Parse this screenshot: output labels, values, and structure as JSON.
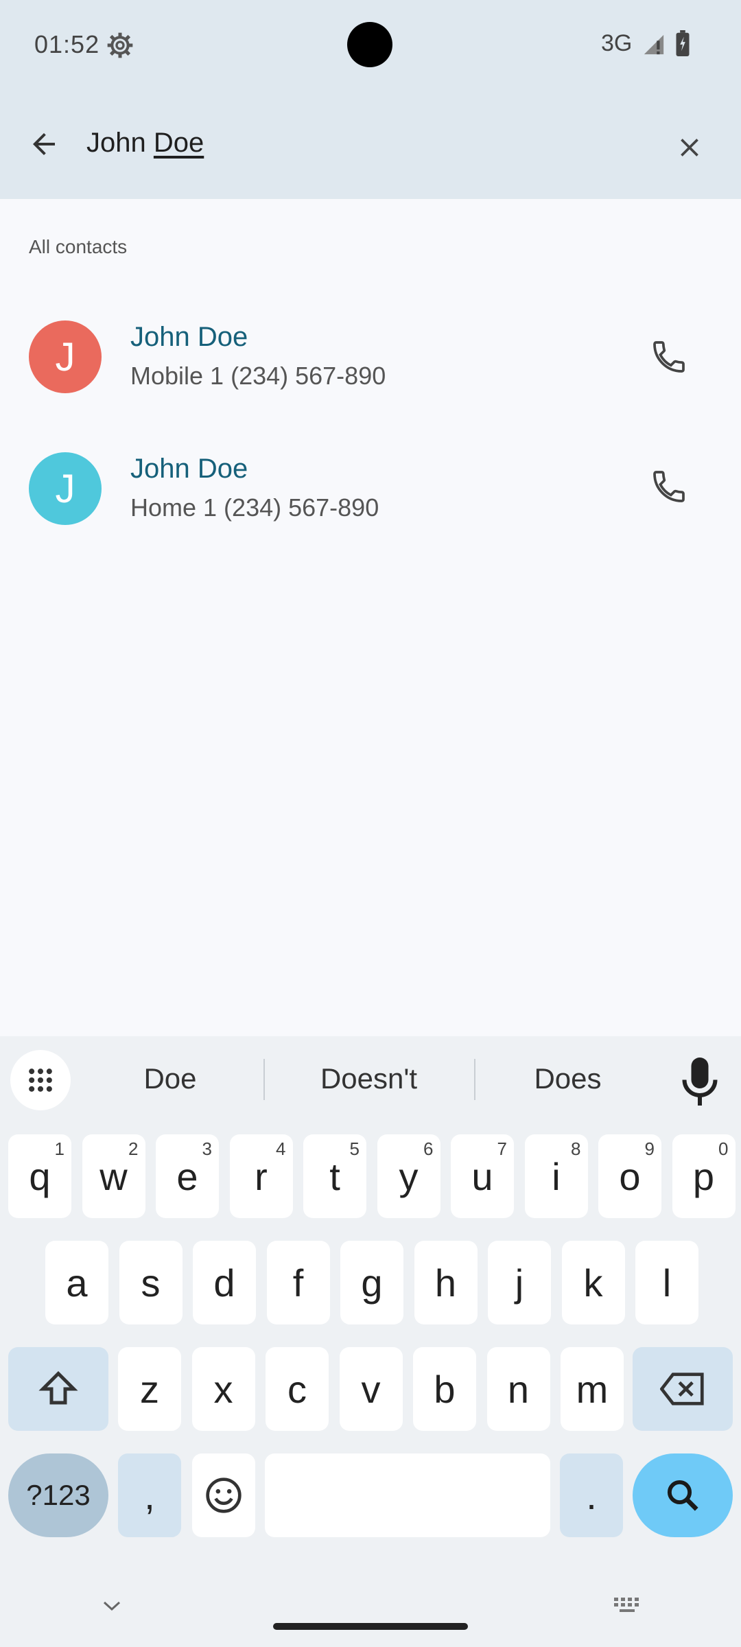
{
  "status_bar": {
    "time": "01:52",
    "network": "3G",
    "icons": [
      "gear-icon",
      "signal-icon",
      "battery-icon"
    ]
  },
  "search": {
    "query_word1": "John",
    "query_word2": "Doe",
    "value": "John Doe"
  },
  "section": {
    "label": "All contacts"
  },
  "contacts": [
    {
      "initial": "J",
      "name": "John Doe",
      "phone": "Mobile 1 (234) 567-890",
      "avatar_color": "#ea6a5d"
    },
    {
      "initial": "J",
      "name": "John Doe",
      "phone": "Home 1 (234) 567-890",
      "avatar_color": "#4fc8dc"
    }
  ],
  "keyboard": {
    "suggestions": [
      "Doe",
      "Doesn't",
      "Does"
    ],
    "row1": [
      {
        "k": "q",
        "h": "1"
      },
      {
        "k": "w",
        "h": "2"
      },
      {
        "k": "e",
        "h": "3"
      },
      {
        "k": "r",
        "h": "4"
      },
      {
        "k": "t",
        "h": "5"
      },
      {
        "k": "y",
        "h": "6"
      },
      {
        "k": "u",
        "h": "7"
      },
      {
        "k": "i",
        "h": "8"
      },
      {
        "k": "o",
        "h": "9"
      },
      {
        "k": "p",
        "h": "0"
      }
    ],
    "row2": [
      "a",
      "s",
      "d",
      "f",
      "g",
      "h",
      "j",
      "k",
      "l"
    ],
    "row3": [
      "z",
      "x",
      "c",
      "v",
      "b",
      "n",
      "m"
    ],
    "sym_label": "?123",
    "comma": ",",
    "period": "."
  },
  "colors": {
    "accent": "#16607a",
    "search_key": "#6fcaf7"
  }
}
